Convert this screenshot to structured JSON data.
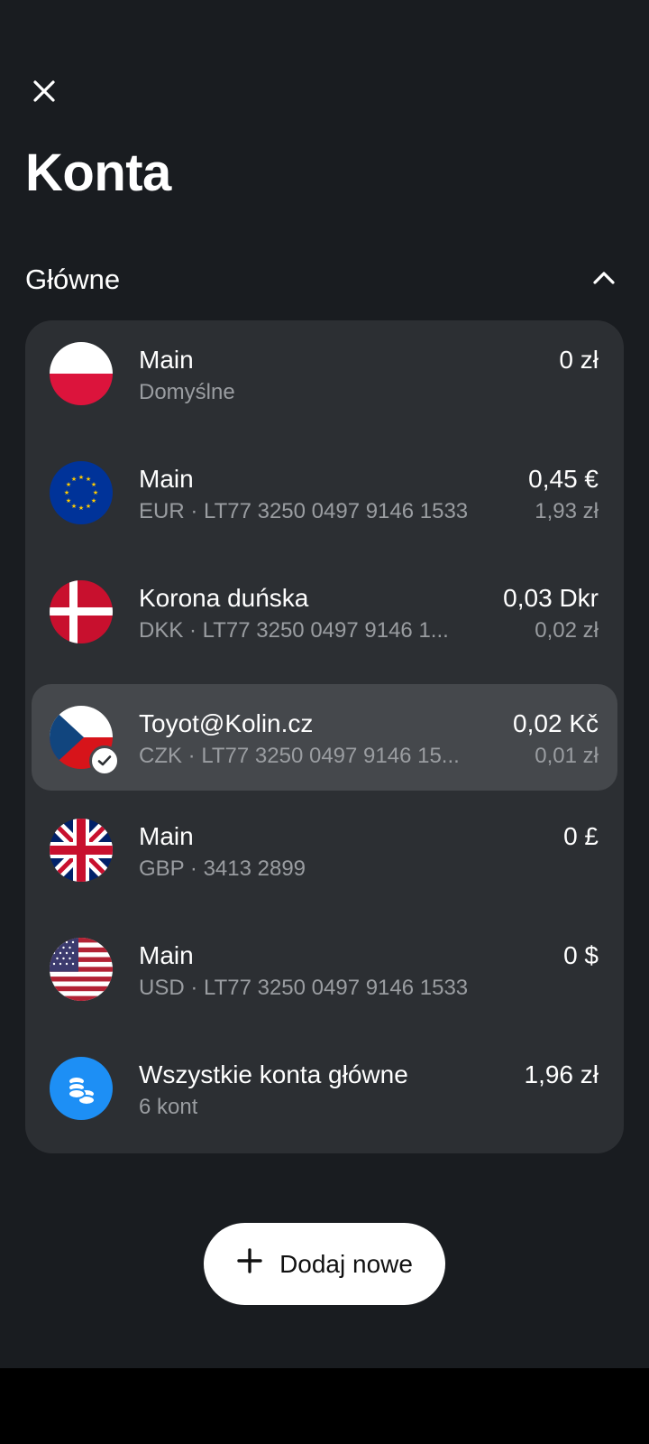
{
  "header": {
    "close_icon": "close-icon",
    "title": "Konta"
  },
  "section": {
    "title": "Główne",
    "collapse_icon": "chevron-up-icon"
  },
  "accounts": [
    {
      "name": "Main",
      "sub": "Domyślne",
      "amount": "0 zł",
      "converted": "",
      "flag": "poland"
    },
    {
      "name": "Main",
      "sub": "EUR · LT77 3250 0497 9146 1533",
      "amount": "0,45 €",
      "converted": "1,93 zł",
      "flag": "eu"
    },
    {
      "name": "Korona duńska",
      "sub": "DKK · LT77 3250 0497 9146 1...",
      "amount": "0,03 Dkr",
      "converted": "0,02 zł",
      "flag": "denmark"
    },
    {
      "name": "Toyot@Kolin.cz",
      "sub": "CZK · LT77 3250 0497 9146 15...",
      "amount": "0,02 Kč",
      "converted": "0,01 zł",
      "flag": "czechia",
      "selected": true
    },
    {
      "name": "Main",
      "sub": "GBP · 3413 2899",
      "amount": "0 £",
      "converted": "",
      "flag": "uk"
    },
    {
      "name": "Main",
      "sub": "USD · LT77 3250 0497 9146 1533",
      "amount": "0 $",
      "converted": "",
      "flag": "usa"
    },
    {
      "name": "Wszystkie konta główne",
      "sub": "6 kont",
      "amount": "1,96 zł",
      "converted": "",
      "flag": "coins"
    }
  ],
  "add_button": {
    "label": "Dodaj nowe",
    "icon": "plus-icon"
  },
  "colors": {
    "background": "#191c20",
    "card": "#2c2f33",
    "selected_row": "#45484c",
    "secondary_text": "#9a9da1",
    "accent_blue": "#1d8ff5"
  }
}
